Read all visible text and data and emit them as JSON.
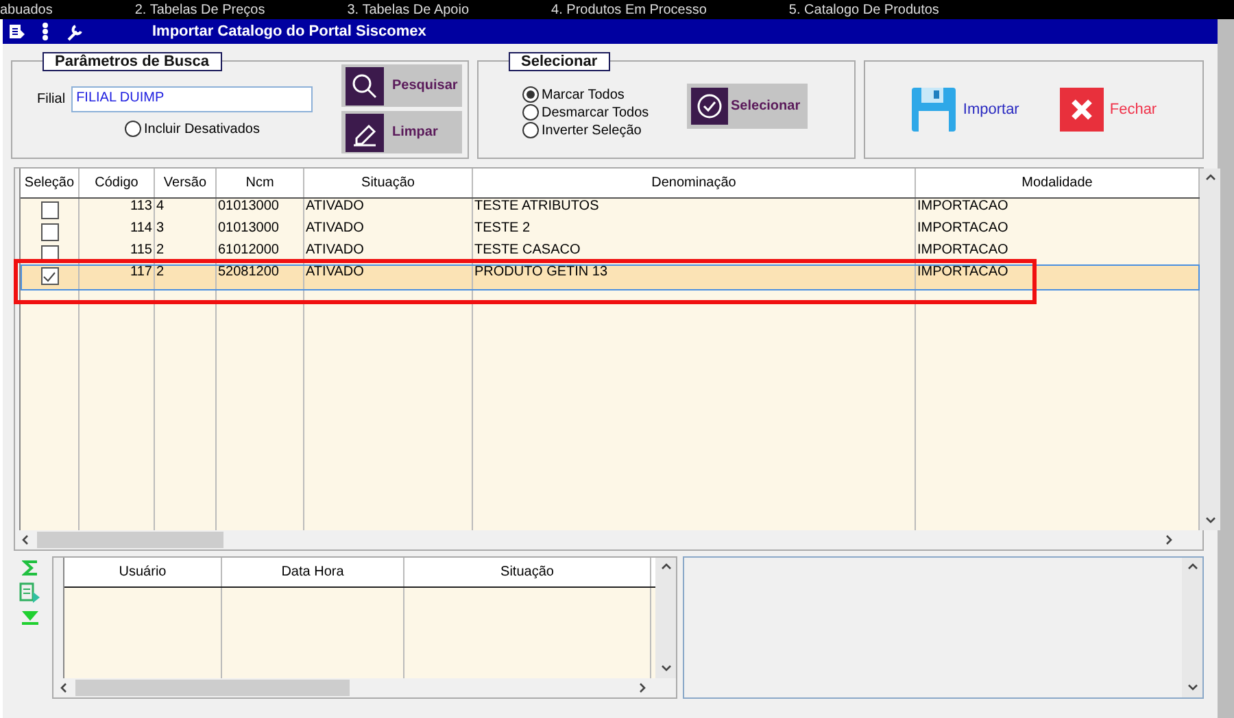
{
  "top_tabs": [
    "abuados",
    "2. Tabelas De Preços",
    "3. Tabelas De Apoio",
    "4. Produtos Em Processo",
    "5. Catalogo De Produtos"
  ],
  "window": {
    "title": "Importar Catalogo do Portal Siscomex"
  },
  "search_params": {
    "title": "Parâmetros de Busca",
    "filial_label": "Filial",
    "filial_value": "FILIAL DUIMP",
    "include_inactive": {
      "label": "Incluir Desativados",
      "selected": false
    },
    "buttons": [
      {
        "label": "Pesquisar",
        "kind": "search"
      },
      {
        "label": "Limpar",
        "kind": "clear"
      }
    ]
  },
  "select_panel": {
    "title": "Selecionar",
    "options": [
      {
        "label": "Marcar Todos",
        "selected": true
      },
      {
        "label": "Desmarcar Todos",
        "selected": false
      },
      {
        "label": "Inverter Seleção",
        "selected": false
      }
    ],
    "button": "Selecionar"
  },
  "actions": [
    {
      "label": "Importar",
      "kind": "save"
    },
    {
      "label": "Fechar",
      "kind": "close"
    }
  ],
  "table": {
    "columns": [
      "Seleção",
      "Código",
      "Versão",
      "Ncm",
      "Situação",
      "Denominação",
      "Modalidade"
    ],
    "rows": [
      {
        "selected": false,
        "cells": [
          {
            "kind": "checkbox",
            "checked": false
          },
          "113",
          "4",
          "01013000",
          "ATIVADO",
          "TESTE ATRIBUTOS",
          "IMPORTACAO"
        ]
      },
      {
        "selected": false,
        "cells": [
          {
            "kind": "checkbox",
            "checked": false
          },
          "114",
          "3",
          "01013000",
          "ATIVADO",
          "TESTE 2",
          "IMPORTACAO"
        ]
      },
      {
        "selected": false,
        "cells": [
          {
            "kind": "checkbox",
            "checked": false
          },
          "115",
          "2",
          "61012000",
          "ATIVADO",
          "TESTE CASACO",
          "IMPORTACAO"
        ]
      },
      {
        "selected": true,
        "cells": [
          {
            "kind": "checkbox",
            "checked": true
          },
          "117",
          "2",
          "52081200",
          "ATIVADO",
          "PRODUTO GETIN 13",
          "IMPORTACAO"
        ]
      }
    ]
  },
  "log_table": {
    "columns": [
      "Usuário",
      "Data Hora",
      "Situação"
    ]
  }
}
